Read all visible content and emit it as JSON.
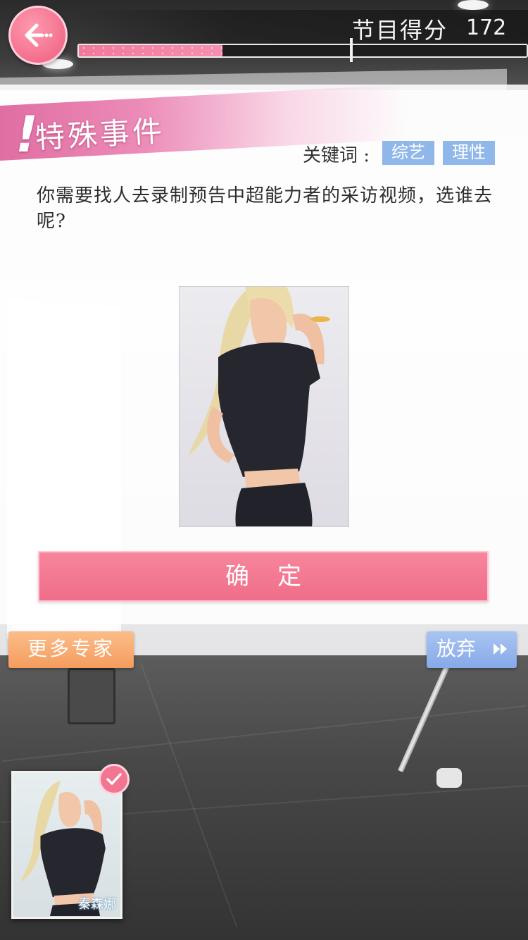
{
  "hud": {
    "score_label": "节目得分",
    "score_value": "172",
    "progress_fraction": 0.32
  },
  "event": {
    "title": "特殊事件",
    "keyword_label": "关键词 :",
    "keywords": [
      "综艺",
      "理性"
    ],
    "question": "你需要找人去录制预告中超能力者的采访视频，选谁去呢?"
  },
  "buttons": {
    "confirm": "确定",
    "more_experts": "更多专家",
    "give_up": "放弃"
  },
  "selected_card": {
    "name": "秦森娜"
  },
  "icons": {
    "back": "back-arrow-icon",
    "give_up": "fast-forward-icon",
    "selected": "checkmark-icon"
  },
  "colors": {
    "accent_pink": "#f06d89",
    "tag_blue": "#8fb7ea",
    "orange": "#f59c5e",
    "blue_button": "#86a9e8"
  }
}
